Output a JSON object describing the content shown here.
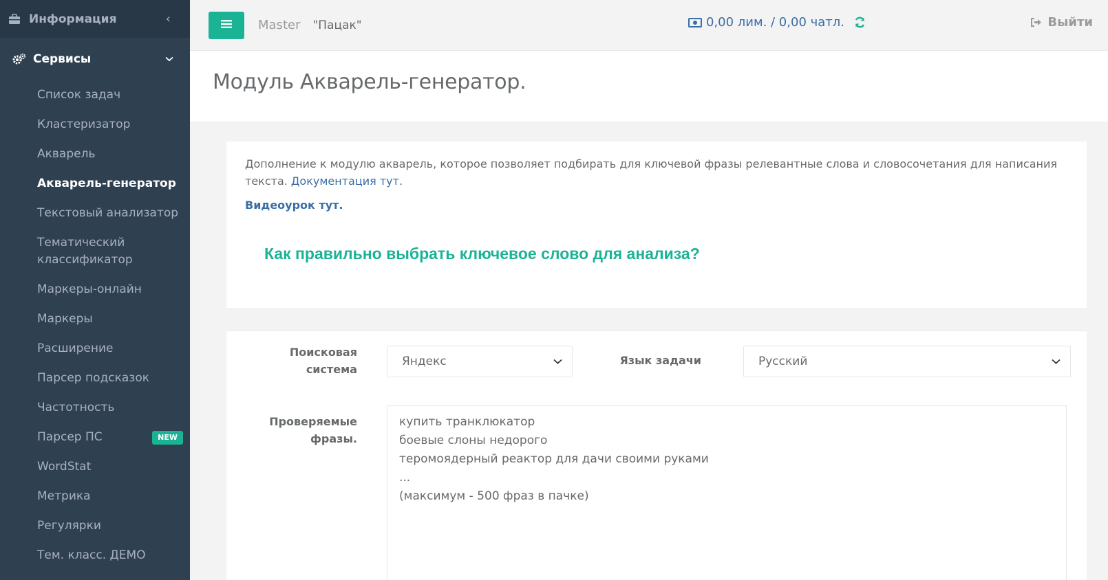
{
  "sidebar": {
    "info_label": "Информация",
    "services_label": "Сервисы",
    "items": [
      {
        "label": "Список задач"
      },
      {
        "label": "Кластеризатор"
      },
      {
        "label": "Акварель"
      },
      {
        "label": "Акварель-генератор",
        "active": true
      },
      {
        "label": "Текстовый анализатор"
      },
      {
        "label": "Тематический классификатор"
      },
      {
        "label": "Маркеры-онлайн"
      },
      {
        "label": "Маркеры"
      },
      {
        "label": "Расширение"
      },
      {
        "label": "Парсер подсказок"
      },
      {
        "label": "Частотность"
      },
      {
        "label": "Парсер ПС",
        "badge": "NEW"
      },
      {
        "label": "WordStat"
      },
      {
        "label": "Метрика"
      },
      {
        "label": "Регулярки"
      },
      {
        "label": "Тем. класс. ДЕМО"
      }
    ]
  },
  "topbar": {
    "role": "Master",
    "username": "\"Пацак\"",
    "balance": "0,00 лим. / 0,00 чатл.",
    "logout": "Выйти"
  },
  "page": {
    "title": "Модуль Акварель-генератор."
  },
  "info": {
    "desc_text": "Дополнение к модулю акварель, которое позволяет подбирать для ключевой фразы релевантные слова и словосочетания для написания текста. ",
    "doc_link": "Документация тут",
    "doc_suffix": ".",
    "video_link": "Видеоурок тут.",
    "howto_title": "Как правильно выбрать ключевое слово для анализа?"
  },
  "form": {
    "search_engine_label": "Поисковая система",
    "search_engine_value": "Яндекс",
    "language_label": "Язык задачи",
    "language_value": "Русский",
    "phrases_label": "Проверяемые фразы.",
    "phrases_placeholder": [
      "купить транклюкатор",
      "боевые слоны недорого",
      "теромоядерный реактор для дачи своими руками",
      "...",
      "(максимум - 500 фраз в пачке)"
    ]
  },
  "colors": {
    "sidebar_bg": "#2f4050",
    "accent": "#1ab394",
    "link": "#3a6ea5"
  }
}
